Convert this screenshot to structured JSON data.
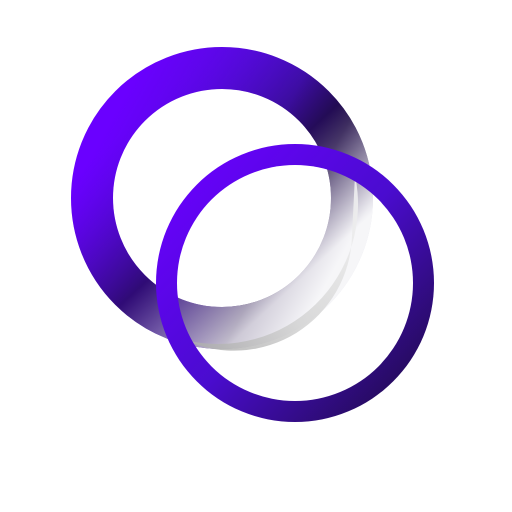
{
  "image": {
    "kind": "logo",
    "icon": "two-interlocking-rings-icon",
    "background_color": "#ffffff"
  },
  "colors": {
    "ring_purple_bright": "#6a00ff",
    "ring_purple_mid": "#3c0a9c",
    "ring_purple_dark": "#1e0b46",
    "shadow_light": "#f2f2f2",
    "shadow_dark": "#bdbdbd"
  }
}
